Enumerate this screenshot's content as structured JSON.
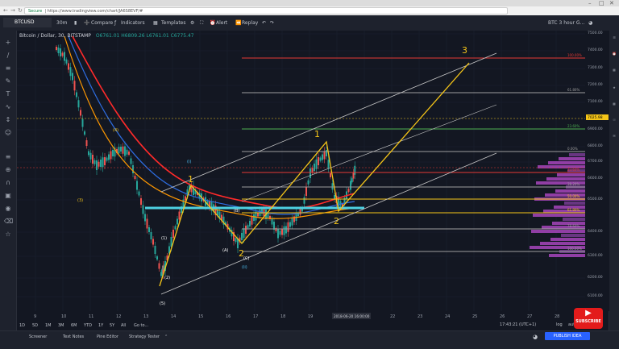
{
  "browser": {
    "secure_label": "Secure",
    "url": "https://www.tradingview.com/chart/JA6S8EVF/#"
  },
  "toolbar": {
    "symbol": "BTCUSD",
    "interval": "30m",
    "compare": "Compare",
    "indicators": "Indicators",
    "templates": "Templates",
    "alert": "Alert",
    "replay": "Replay",
    "right_title": "BTC 3 hour G..."
  },
  "legend": {
    "title": "Bitcoin / Dollar, 30, BITSTAMP",
    "o": "O6761.01",
    "h": "H6809.26",
    "l": "L6761.01",
    "c": "C6775.47"
  },
  "price_axis": [
    "7500.00",
    "7400.00",
    "7300.00",
    "7200.00",
    "7100.00",
    "7025.98",
    "6900.00",
    "6800.00",
    "6700.00",
    "6600.00",
    "6500.00",
    "6400.00",
    "6300.00",
    "6200.00",
    "6100.00"
  ],
  "time_axis": [
    "9",
    "10",
    "11",
    "12",
    "13",
    "14",
    "15",
    "16",
    "17",
    "18",
    "19",
    "20",
    "21",
    "22",
    "23",
    "24",
    "25",
    "26",
    "27",
    "28"
  ],
  "cursor_time": "2018-06-20 16:00:00",
  "fib_labels": [
    "100.00%",
    "61.80%",
    "23.60%",
    "0.00%",
    "23.60%",
    "38.20%",
    "50.00%",
    "61.80%",
    "78.60%",
    "100.00%"
  ],
  "wave_labels": {
    "w1": "1",
    "w2": "2",
    "w3": "3",
    "wb": "1",
    "wc": "2",
    "s1": "(1)",
    "s2": "(2)",
    "s3": "(3)",
    "s4": "(4)",
    "s5": "(5)",
    "i": "(i)",
    "ii": "(ii)",
    "A": "(A)",
    "B": "(B)",
    "C": "(C)"
  },
  "bottom": {
    "screener": "Screener",
    "text_notes": "Text Notes",
    "pine_editor": "Pine Editor",
    "strategy_tester": "Strategy Tester",
    "time": "17:43:21 (UTC+1)",
    "log": "log",
    "auto": "auto",
    "publish": "PUBLISH IDEA"
  },
  "periods": [
    "1D",
    "5D",
    "1M",
    "3M",
    "6M",
    "YTD",
    "1Y",
    "5Y",
    "All",
    "Go to..."
  ],
  "youtube": {
    "label": "SUBSCRIBE"
  },
  "colors": {
    "background": "#131722",
    "wave_line": "#f5c518",
    "fib_red": "#e53935",
    "fib_green": "#4caf50",
    "ma_red": "#ff2a2a",
    "ma_blue": "#2d6cdf",
    "ma_orange": "#ff9800",
    "channel": "#c8c8c8",
    "cyan_zone": "#4dd0e1"
  }
}
